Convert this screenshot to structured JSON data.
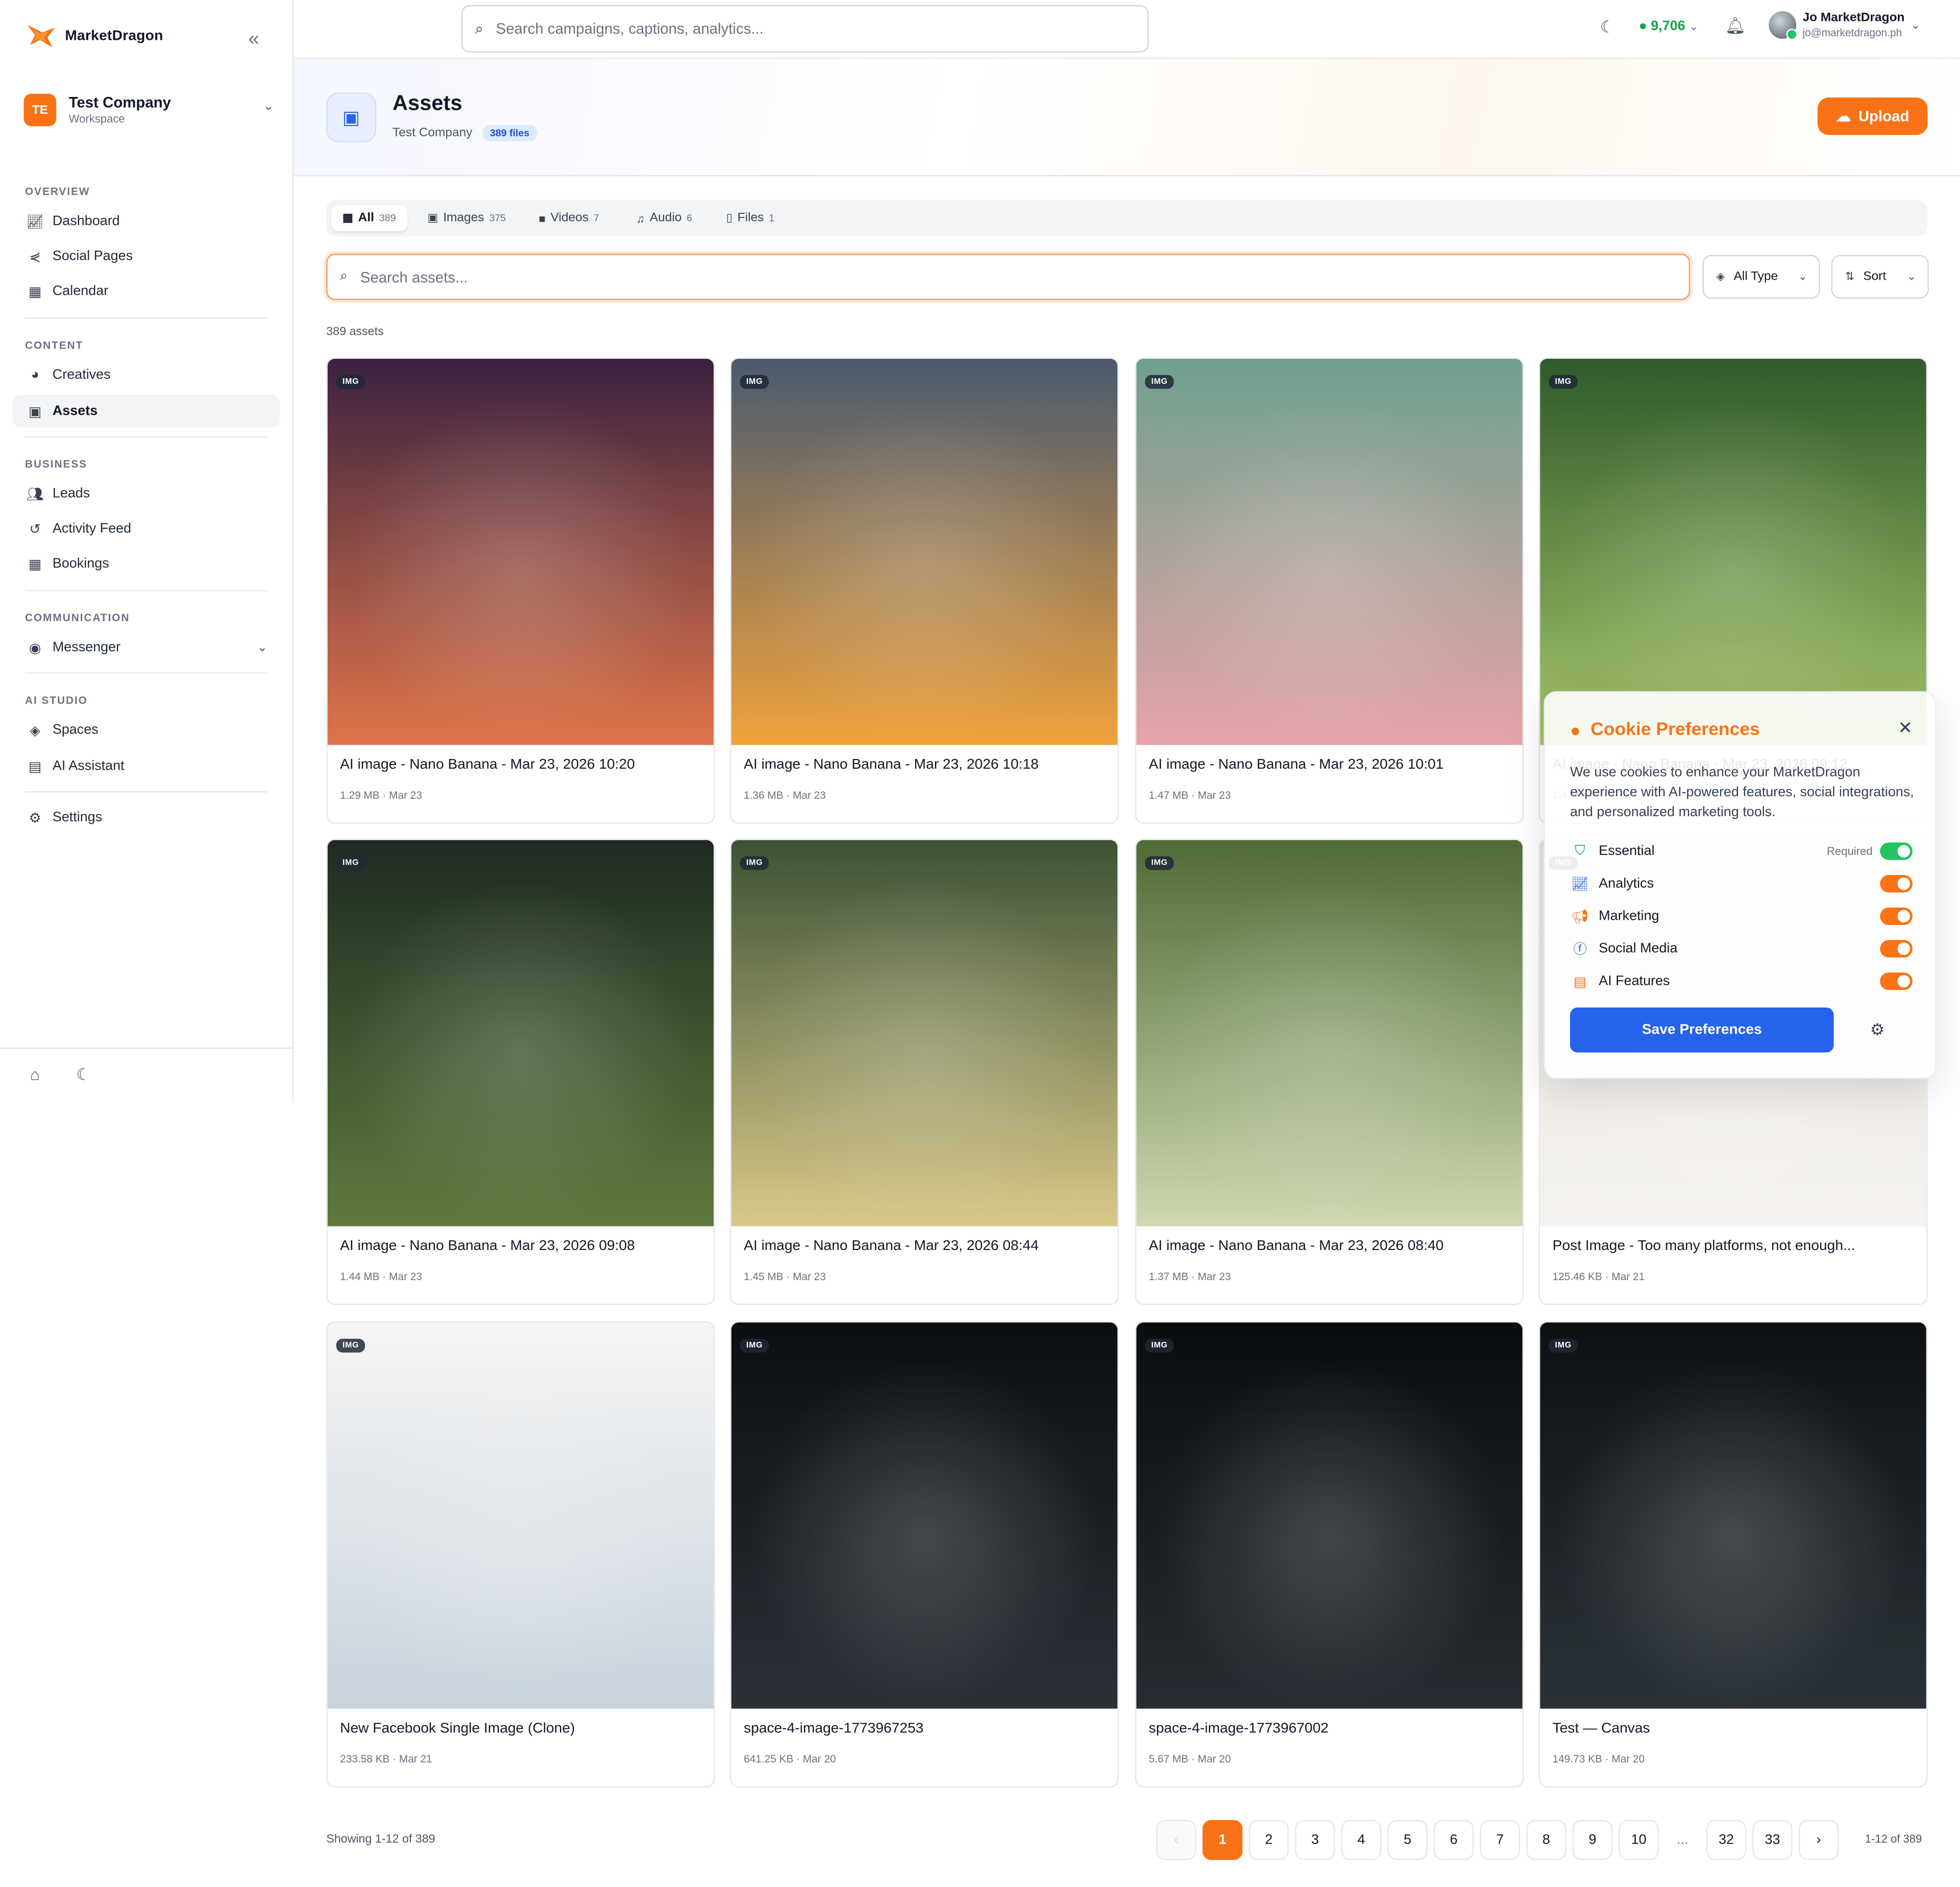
{
  "brand": {
    "name": "MarketDragon"
  },
  "workspace": {
    "initials": "TE",
    "name": "Test Company",
    "sub": "Workspace"
  },
  "sidebar": {
    "sections": {
      "overview": "OVERVIEW",
      "content": "CONTENT",
      "business": "BUSINESS",
      "communication": "COMMUNICATION",
      "ai_studio": "AI STUDIO"
    },
    "items": {
      "dashboard": "Dashboard",
      "social_pages": "Social Pages",
      "calendar": "Calendar",
      "creatives": "Creatives",
      "assets": "Assets",
      "leads": "Leads",
      "activity_feed": "Activity Feed",
      "bookings": "Bookings",
      "messenger": "Messenger",
      "spaces": "Spaces",
      "ai_assistant": "AI Assistant",
      "settings": "Settings"
    },
    "active": "assets"
  },
  "topbar": {
    "search_placeholder": "Search campaigns, captions, analytics...",
    "credits": "9,706",
    "user_name": "Jo MarketDragon",
    "user_email": "jo@marketdragon.ph"
  },
  "header": {
    "title": "Assets",
    "company": "Test Company",
    "files_badge": "389 files",
    "upload_label": "Upload"
  },
  "tabs": [
    {
      "label": "All",
      "count": "389"
    },
    {
      "label": "Images",
      "count": "375"
    },
    {
      "label": "Videos",
      "count": "7"
    },
    {
      "label": "Audio",
      "count": "6"
    },
    {
      "label": "Files",
      "count": "1"
    }
  ],
  "filters": {
    "search_placeholder": "Search assets...",
    "type_label": "All Type",
    "sort_label": "Sort"
  },
  "asset_count": "389 assets",
  "assets": [
    {
      "badge": "IMG",
      "title": "AI image - Nano Banana - Mar 23, 2026 10:20",
      "meta": "1.29 MB · Mar 23",
      "colors": [
        "#3b2240",
        "#e0754a"
      ]
    },
    {
      "badge": "IMG",
      "title": "AI image - Nano Banana - Mar 23, 2026 10:18",
      "meta": "1.36 MB · Mar 23",
      "colors": [
        "#4b5a6e",
        "#f0a23c"
      ]
    },
    {
      "badge": "IMG",
      "title": "AI image - Nano Banana - Mar 23, 2026 10:01",
      "meta": "1.47 MB · Mar 23",
      "colors": [
        "#6fa08e",
        "#e7a4a8"
      ]
    },
    {
      "badge": "IMG",
      "title": "AI image - Nano Banana - Mar 23, 2026 09:12",
      "meta": "1.4 MB · Mar 23",
      "colors": [
        "#2f5a2a",
        "#a6c46a"
      ]
    },
    {
      "badge": "IMG",
      "title": "AI image - Nano Banana - Mar 23, 2026 09:08",
      "meta": "1.44 MB · Mar 23",
      "colors": [
        "#1f2a22",
        "#5f7a3e"
      ]
    },
    {
      "badge": "IMG",
      "title": "AI image - Nano Banana - Mar 23, 2026 08:44",
      "meta": "1.45 MB · Mar 23",
      "colors": [
        "#3d5235",
        "#d8c98a"
      ]
    },
    {
      "badge": "IMG",
      "title": "AI image - Nano Banana - Mar 23, 2026 08:40",
      "meta": "1.37 MB · Mar 23",
      "colors": [
        "#4f6b36",
        "#cfd8b0"
      ]
    },
    {
      "badge": "IMG",
      "title": "Post Image - Too many platforms, not enough...",
      "meta": "125.46 KB · Mar 21",
      "colors": [
        "#e9e3dc",
        "#f4f2ef"
      ]
    },
    {
      "badge": "IMG",
      "title": "New Facebook Single Image (Clone)",
      "meta": "233.58 KB · Mar 21",
      "colors": [
        "#f5f5f5",
        "#c9d3dc"
      ]
    },
    {
      "badge": "IMG",
      "title": "space-4-image-1773967253",
      "meta": "641.25 KB · Mar 20",
      "colors": [
        "#0b0f12",
        "#2a3036"
      ]
    },
    {
      "badge": "IMG",
      "title": "space-4-image-1773967002",
      "meta": "5.67 MB · Mar 20",
      "colors": [
        "#0a0d10",
        "#262c31"
      ]
    },
    {
      "badge": "IMG",
      "title": "Test — Canvas",
      "meta": "149.73 KB · Mar 20",
      "colors": [
        "#0d1114",
        "#2b3237"
      ]
    }
  ],
  "pagination": {
    "showing": "Showing 1-12 of 389",
    "pages": [
      "1",
      "2",
      "3",
      "4",
      "5",
      "6",
      "7",
      "8",
      "9",
      "10",
      "...",
      "32",
      "33"
    ],
    "prev": "‹",
    "next": "›",
    "range": "1-12 of 389"
  },
  "cookie": {
    "title": "Cookie Preferences",
    "text": "We use cookies to enhance your MarketDragon experience with AI-powered features, social integrations, and personalized marketing tools.",
    "required_label": "Required",
    "prefs": [
      {
        "label": "Essential",
        "color": "#22c55e",
        "icon_color": "#16a34a"
      },
      {
        "label": "Analytics",
        "color": "#f97316",
        "icon_color": "#2563eb"
      },
      {
        "label": "Marketing",
        "color": "#f97316",
        "icon_color": "#f97316"
      },
      {
        "label": "Social Media",
        "color": "#f97316",
        "icon_color": "#2563eb"
      },
      {
        "label": "AI Features",
        "color": "#f97316",
        "icon_color": "#f97316"
      }
    ],
    "save_label": "Save Preferences"
  }
}
